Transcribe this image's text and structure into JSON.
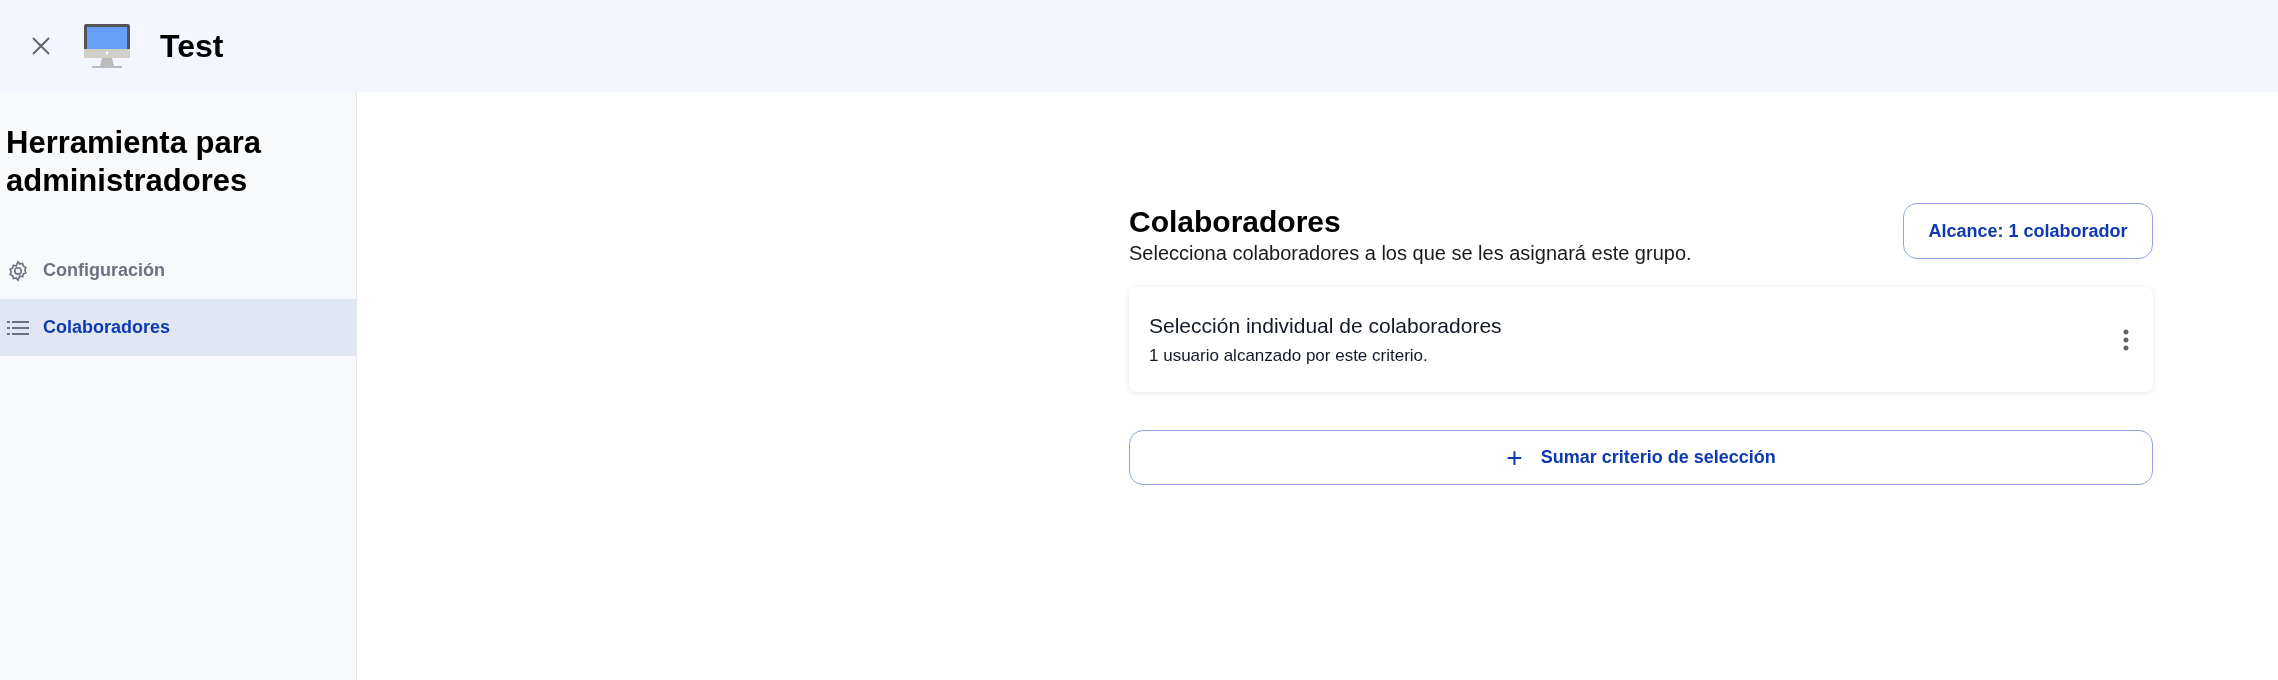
{
  "header": {
    "title": "Test"
  },
  "sidebar": {
    "title": "Herramienta para administradores",
    "items": [
      {
        "label": "Configuración",
        "kind": "settings",
        "selected": false
      },
      {
        "label": "Colaboradores",
        "kind": "list",
        "selected": true
      }
    ]
  },
  "section": {
    "title": "Colaboradores",
    "subtitle": "Selecciona colaboradores a los que se les asignará este grupo.",
    "scope_button": "Alcance: 1 colaborador"
  },
  "criteria": [
    {
      "title": "Selección individual de colaboradores",
      "description": "1 usuario alcanzado por este criterio."
    }
  ],
  "add_button": {
    "label": "Sumar criterio de selección",
    "icon": "+"
  }
}
